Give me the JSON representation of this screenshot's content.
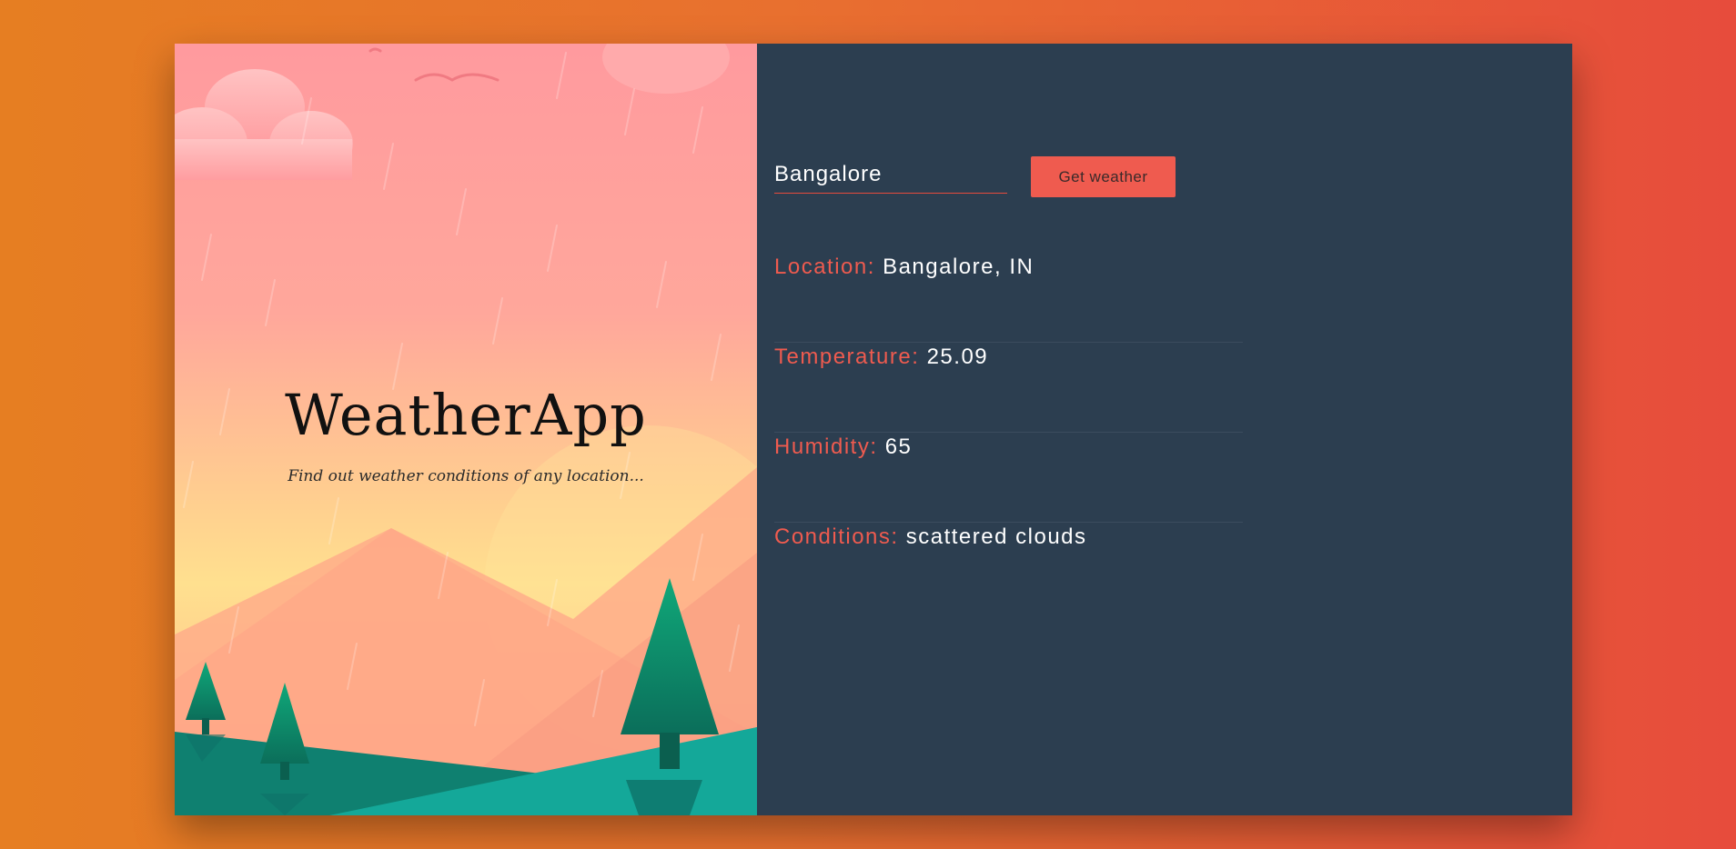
{
  "brand": {
    "title": "WeatherApp",
    "subtitle": "Find out weather conditions of any location..."
  },
  "search": {
    "value": "Bangalore",
    "button_label": "Get weather"
  },
  "info": [
    {
      "label": "Location:",
      "value": "Bangalore, IN"
    },
    {
      "label": "Temperature:",
      "value": "25.09"
    },
    {
      "label": "Humidity:",
      "value": "65"
    },
    {
      "label": "Conditions:",
      "value": "scattered clouds"
    }
  ],
  "colors": {
    "background_start": "#e67e22",
    "background_end": "#e74c3c",
    "panel": "#2c3e50",
    "accent": "#ef5b4f",
    "text": "#ffffff"
  },
  "icons": [
    "cloud-icon",
    "bird-icon",
    "mountain-icon",
    "tree-icon",
    "rain-icon"
  ]
}
